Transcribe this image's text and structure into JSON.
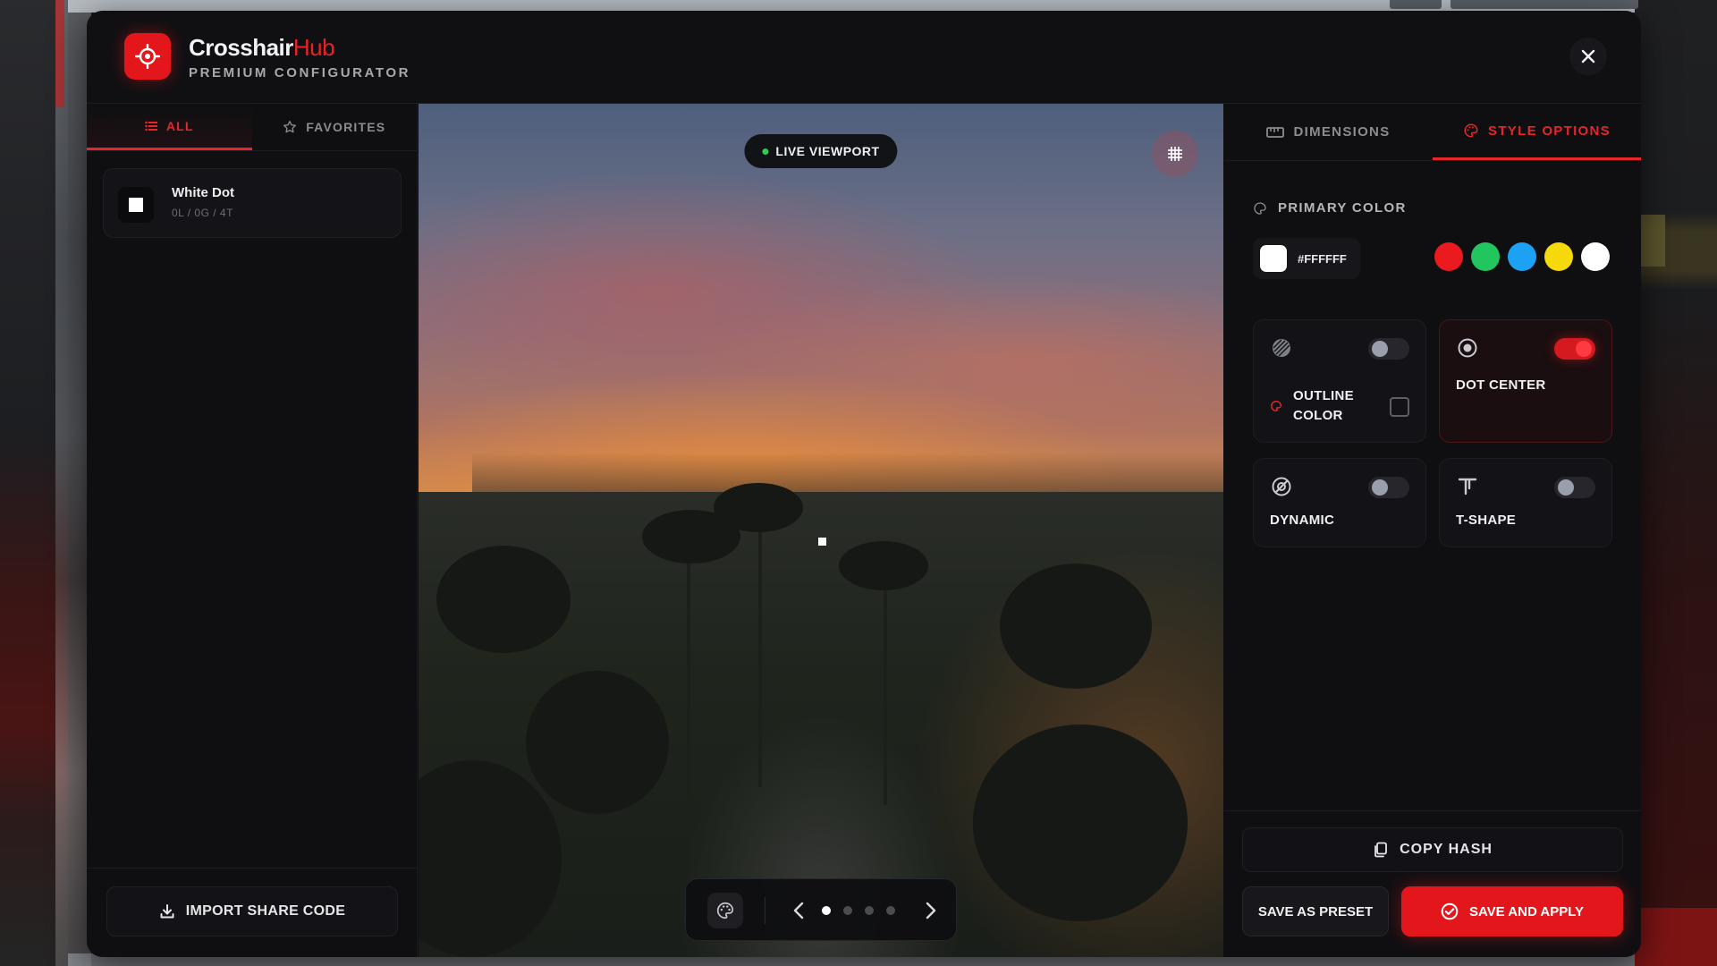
{
  "app": {
    "title_main": "Crosshair",
    "title_accent": "Hub",
    "subtitle": "PREMIUM CONFIGURATOR",
    "logo_icon": "target-icon",
    "close_icon": "close-icon",
    "accent_color": "#e3171b"
  },
  "sidebar": {
    "tabs": [
      {
        "label": "ALL",
        "icon": "list-icon",
        "active": true
      },
      {
        "label": "FAVORITES",
        "icon": "star-icon",
        "active": false
      }
    ],
    "presets": [
      {
        "name": "White Dot",
        "meta": "0L / 0G / 4T",
        "icon": "white-square-icon"
      }
    ],
    "import_label": "IMPORT SHARE CODE",
    "import_icon": "download-icon"
  },
  "viewport": {
    "live_label": "LIVE VIEWPORT",
    "grid_icon": "grid-icon",
    "carousel": {
      "palette_icon": "palette-icon",
      "prev_icon": "chevron-left-icon",
      "next_icon": "chevron-right-icon",
      "page_count": 4,
      "active_page": 1
    }
  },
  "panel": {
    "tabs": [
      {
        "label": "DIMENSIONS",
        "icon": "ruler-icon",
        "active": false
      },
      {
        "label": "STYLE OPTIONS",
        "icon": "palette-icon",
        "active": true
      }
    ],
    "primary_color_label": "PRIMARY COLOR",
    "primary_color_value": "#FFFFFF",
    "swatches": [
      "#ea1a1f",
      "#22c55e",
      "#1da1f2",
      "#f5d90a",
      "#ffffff"
    ],
    "options": {
      "outline": {
        "label_line1": "OUTLINE",
        "label_line2": "COLOR",
        "enabled": false,
        "checked": false
      },
      "dot_center": {
        "label": "DOT CENTER",
        "enabled": true
      },
      "dynamic": {
        "label": "DYNAMIC",
        "enabled": false
      },
      "t_shape": {
        "label": "T-SHAPE",
        "enabled": false
      }
    },
    "copy_hash_label": "COPY HASH",
    "save_preset_label": "SAVE AS PRESET",
    "save_apply_label": "SAVE AND APPLY"
  }
}
